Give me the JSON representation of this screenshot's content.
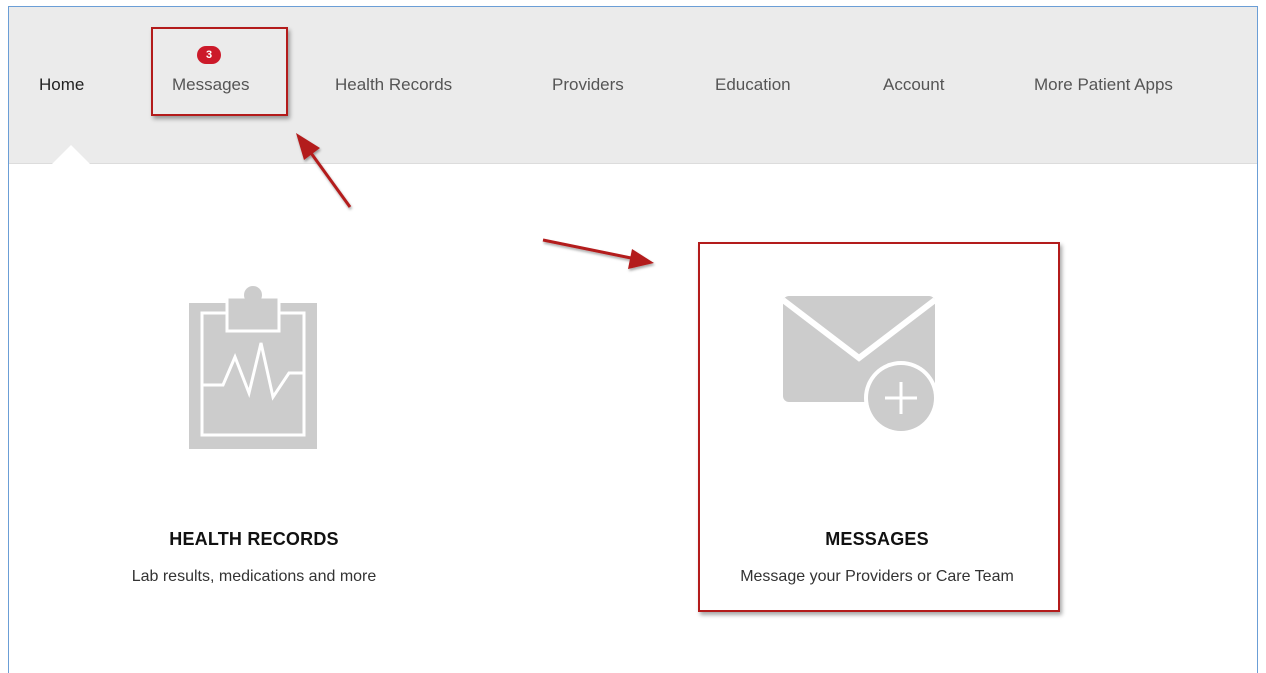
{
  "nav": {
    "items": [
      {
        "id": "home",
        "label": "Home",
        "active": true
      },
      {
        "id": "messages",
        "label": "Messages",
        "badge": "3"
      },
      {
        "id": "health-records",
        "label": "Health Records"
      },
      {
        "id": "providers",
        "label": "Providers"
      },
      {
        "id": "education",
        "label": "Education"
      },
      {
        "id": "account",
        "label": "Account"
      },
      {
        "id": "more-patient-apps",
        "label": "More Patient Apps"
      }
    ]
  },
  "tiles": {
    "health_records": {
      "title": "HEALTH RECORDS",
      "subtitle": "Lab results, medications and more",
      "icon": "clipboard-heartbeat-icon"
    },
    "messages": {
      "title": "MESSAGES",
      "subtitle": "Message your Providers or Care Team",
      "icon": "envelope-plus-icon"
    }
  },
  "colors": {
    "nav_background": "#ebebeb",
    "badge": "#cc1a2a",
    "annotation": "#b31b1b",
    "icon_gray": "#cccccc"
  }
}
